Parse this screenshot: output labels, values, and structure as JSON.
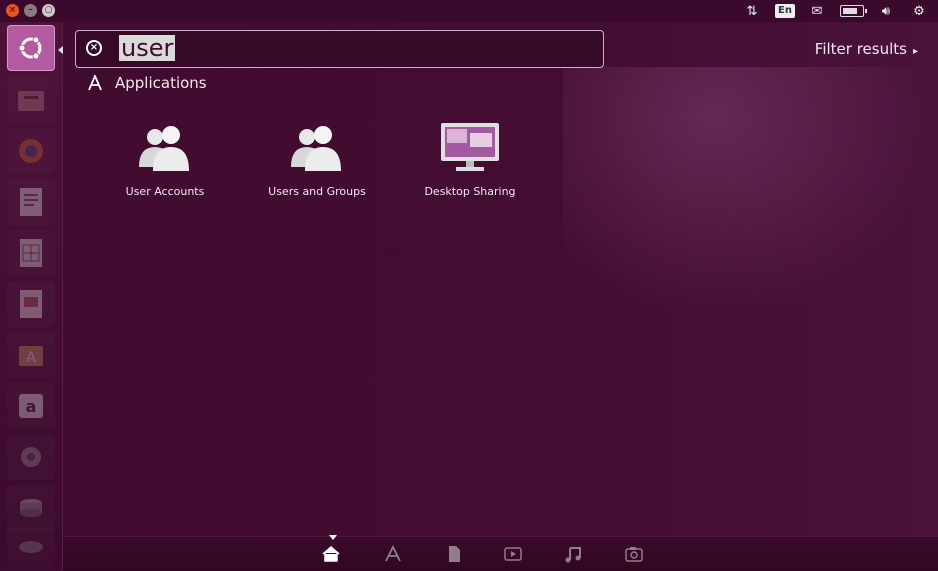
{
  "topbar": {
    "language": "En",
    "window_buttons": [
      "close",
      "minimize",
      "maximize"
    ],
    "tray_icons": [
      "network-icon",
      "language-indicator",
      "mail-icon",
      "battery-icon",
      "volume-icon",
      "gear-icon"
    ]
  },
  "launcher": {
    "items": [
      "ubuntu-logo-icon",
      "files-icon",
      "firefox-icon",
      "writer-icon",
      "calc-icon",
      "impress-icon",
      "software-center-icon",
      "amazon-icon",
      "settings-icon",
      "disks-icon",
      "trash-icon"
    ]
  },
  "search": {
    "query": "user"
  },
  "header": {
    "filter_label": "Filter results"
  },
  "section": {
    "title": "Applications"
  },
  "results": [
    {
      "label": "User Accounts",
      "icon": "users-icon"
    },
    {
      "label": "Users and Groups",
      "icon": "users-icon"
    },
    {
      "label": "Desktop Sharing",
      "icon": "desktop-sharing-icon"
    }
  ],
  "lenses": [
    "home-lens",
    "applications-lens",
    "files-lens",
    "video-lens",
    "music-lens",
    "photos-lens"
  ],
  "colors": {
    "background": "#3f0b2f",
    "accent": "#e95420",
    "launcher_highlight": "#b35aa0"
  }
}
